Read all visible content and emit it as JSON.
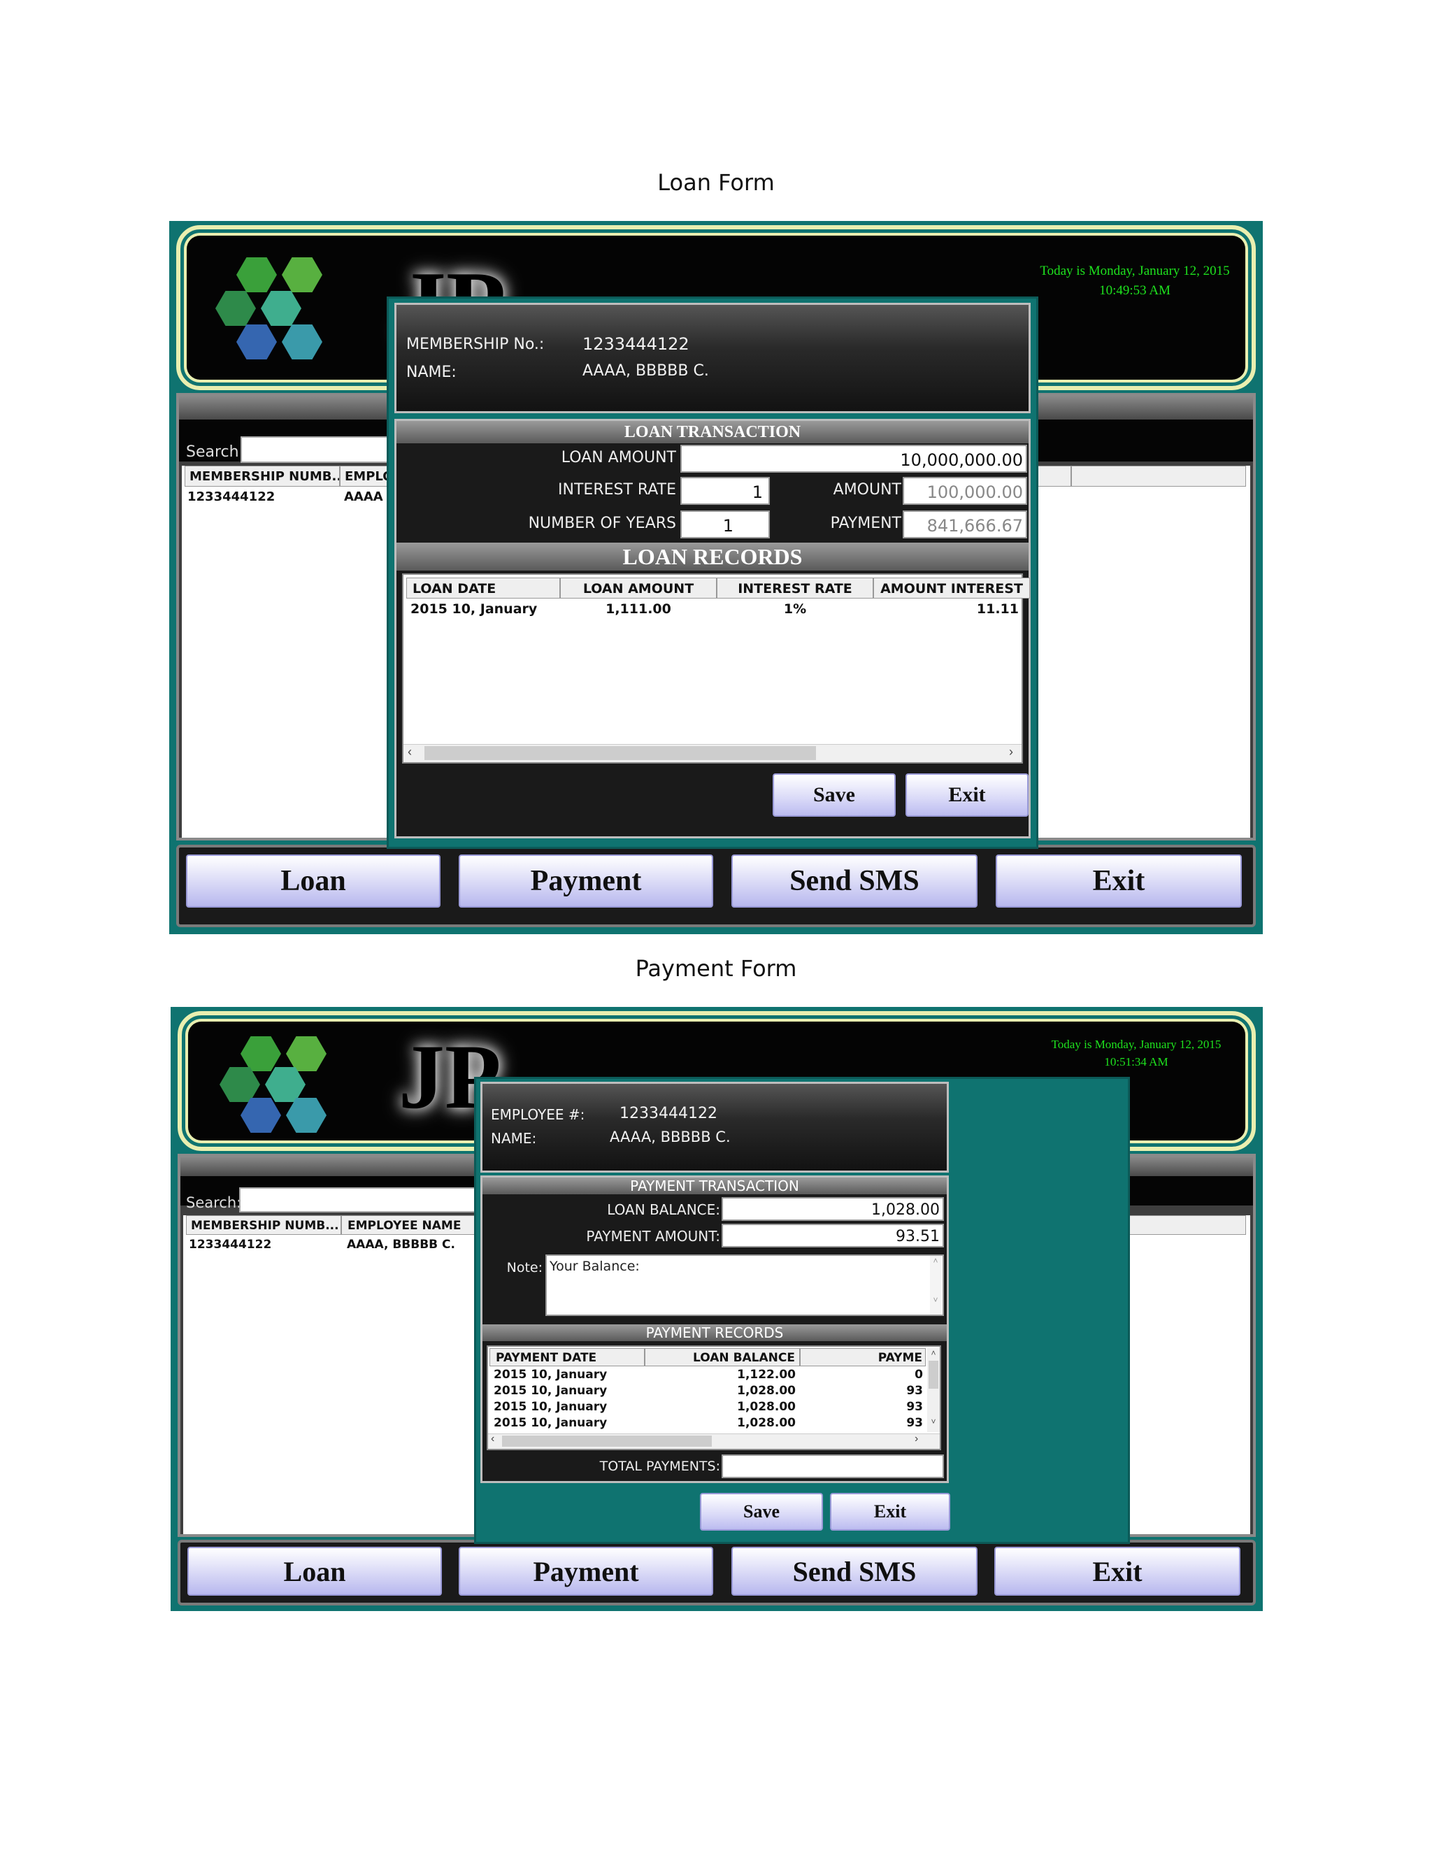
{
  "captions": {
    "loan": "Loan Form",
    "payment": "Payment Form"
  },
  "loan_form": {
    "header": {
      "logo_text": "JP",
      "date_line1": "Today is  Monday, January 12, 2015",
      "date_line2": "10:49:53 AM"
    },
    "search_label": "Search:",
    "grid": {
      "col1": "MEMBERSHIP NUMB...",
      "col2": "EMPLO",
      "row1_col1": "1233444122",
      "row1_col2": "AAAA"
    },
    "modal": {
      "membership_label": "MEMBERSHIP No.:",
      "membership_value": "1233444122",
      "name_label": "NAME:",
      "name_value": "AAAA, BBBBB C.",
      "transaction_title": "LOAN TRANSACTION",
      "loan_amount_label": "LOAN AMOUNT",
      "loan_amount_value": "10,000,000.00",
      "interest_rate_label": "INTEREST RATE",
      "interest_rate_value": "1",
      "amount_label": "AMOUNT",
      "amount_value": "100,000.00",
      "years_label": "NUMBER OF YEARS",
      "years_value": "1",
      "payment_label": "PAYMENT",
      "payment_value": "841,666.67",
      "records_title": "LOAN RECORDS",
      "records_headers": [
        "LOAN DATE",
        "LOAN AMOUNT",
        "INTEREST RATE",
        "AMOUNT INTEREST"
      ],
      "records_rows": [
        [
          "2015 10, January",
          "1,111.00",
          "1%",
          "11.11"
        ]
      ],
      "save_label": "Save",
      "exit_label": "Exit"
    },
    "buttons": {
      "loan": "Loan",
      "payment": "Payment",
      "sms": "Send SMS",
      "exit": "Exit"
    }
  },
  "payment_form": {
    "header": {
      "logo_text": "JP",
      "date_line1": "Today is  Monday, January 12, 2015",
      "date_line2": "10:51:34 AM"
    },
    "search_label": "Search:",
    "grid": {
      "col1": "MEMBERSHIP NUMB...",
      "col2": "EMPLOYEE NAME",
      "row1_col1": "1233444122",
      "row1_col2": "AAAA, BBBBB C."
    },
    "modal": {
      "employee_label": "EMPLOYEE #:",
      "employee_value": "1233444122",
      "name_label": "NAME:",
      "name_value": "AAAA, BBBBB C.",
      "transaction_title": "PAYMENT TRANSACTION",
      "loan_balance_label": "LOAN BALANCE:",
      "loan_balance_value": "1,028.00",
      "payment_amount_label": "PAYMENT AMOUNT:",
      "payment_amount_value": "93.51",
      "note_label": "Note:",
      "note_value": "Your Balance:",
      "records_title": "PAYMENT RECORDS",
      "records_headers": [
        "PAYMENT DATE",
        "LOAN BALANCE",
        "PAYME"
      ],
      "records_rows": [
        [
          "2015 10, January",
          "1,122.00",
          "0"
        ],
        [
          "2015 10, January",
          "1,028.00",
          "93"
        ],
        [
          "2015 10, January",
          "1,028.00",
          "93"
        ],
        [
          "2015 10, January",
          "1,028.00",
          "93"
        ]
      ],
      "total_label": "TOTAL PAYMENTS:",
      "save_label": "Save",
      "exit_label": "Exit"
    },
    "buttons": {
      "loan": "Loan",
      "payment": "Payment",
      "sms": "Send SMS",
      "exit": "Exit"
    }
  },
  "colors": {
    "frame": "#0f7370",
    "date_text": "#1ee21e",
    "button": "#d8d8f6"
  }
}
